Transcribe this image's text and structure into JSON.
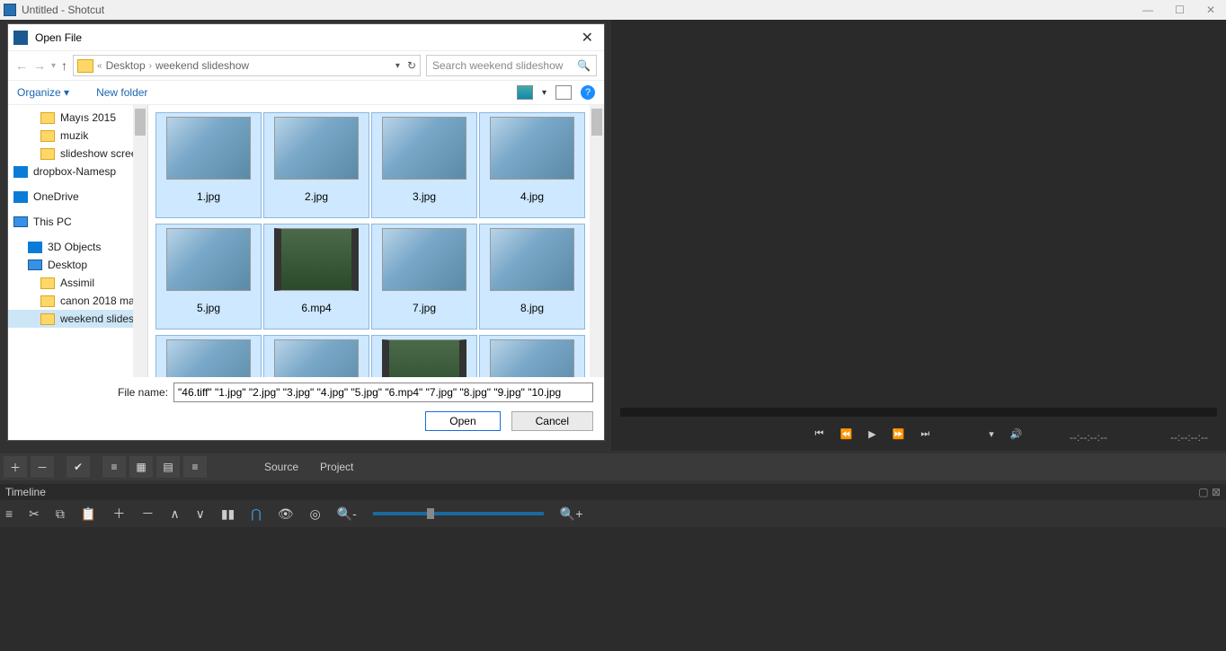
{
  "app": {
    "title": "Untitled - Shotcut"
  },
  "dialog": {
    "title": "Open File",
    "path": {
      "segments": [
        "Desktop",
        "weekend slideshow"
      ],
      "prefix_chev": "«"
    },
    "search": {
      "placeholder": "Search weekend slideshow"
    },
    "toolbar": {
      "organize": "Organize",
      "new_folder": "New folder"
    },
    "tree": [
      {
        "label": "Mayıs 2015",
        "indent": 2,
        "icon": "fold"
      },
      {
        "label": "muzik",
        "indent": 2,
        "icon": "fold"
      },
      {
        "label": "slideshow screen",
        "indent": 2,
        "icon": "fold"
      },
      {
        "label": "dropbox-Namesp",
        "indent": 0,
        "icon": "svc"
      },
      {
        "label": "OneDrive",
        "indent": 0,
        "icon": "svc"
      },
      {
        "label": "This PC",
        "indent": 0,
        "icon": "desk"
      },
      {
        "label": "3D Objects",
        "indent": 1,
        "icon": "svc"
      },
      {
        "label": "Desktop",
        "indent": 1,
        "icon": "desk"
      },
      {
        "label": "Assimil",
        "indent": 2,
        "icon": "fold"
      },
      {
        "label": "canon 2018 ma",
        "indent": 2,
        "icon": "fold"
      },
      {
        "label": "weekend slides",
        "indent": 2,
        "icon": "fold",
        "selected": true
      }
    ],
    "files": [
      {
        "name": "1.jpg",
        "type": "image",
        "selected": true
      },
      {
        "name": "2.jpg",
        "type": "image",
        "selected": true
      },
      {
        "name": "3.jpg",
        "type": "image",
        "selected": true
      },
      {
        "name": "4.jpg",
        "type": "image",
        "selected": true
      },
      {
        "name": "5.jpg",
        "type": "image",
        "selected": true
      },
      {
        "name": "6.mp4",
        "type": "video",
        "selected": true
      },
      {
        "name": "7.jpg",
        "type": "image",
        "selected": true
      },
      {
        "name": "8.jpg",
        "type": "image",
        "selected": true
      },
      {
        "name": "",
        "type": "image",
        "selected": true
      },
      {
        "name": "",
        "type": "image",
        "selected": true
      },
      {
        "name": "",
        "type": "video",
        "selected": true
      },
      {
        "name": "",
        "type": "image",
        "selected": true
      }
    ],
    "footer": {
      "file_label": "File name:",
      "file_value": "\"46.tiff\" \"1.jpg\" \"2.jpg\" \"3.jpg\" \"4.jpg\" \"5.jpg\" \"6.mp4\" \"7.jpg\" \"8.jpg\" \"9.jpg\" \"10.jpg",
      "open": "Open",
      "cancel": "Cancel"
    }
  },
  "player": {
    "time1": "--:--:--:--",
    "time2": "--:--:--:--"
  },
  "mid_tabs": {
    "source": "Source",
    "project": "Project"
  },
  "timeline": {
    "label": "Timeline"
  }
}
